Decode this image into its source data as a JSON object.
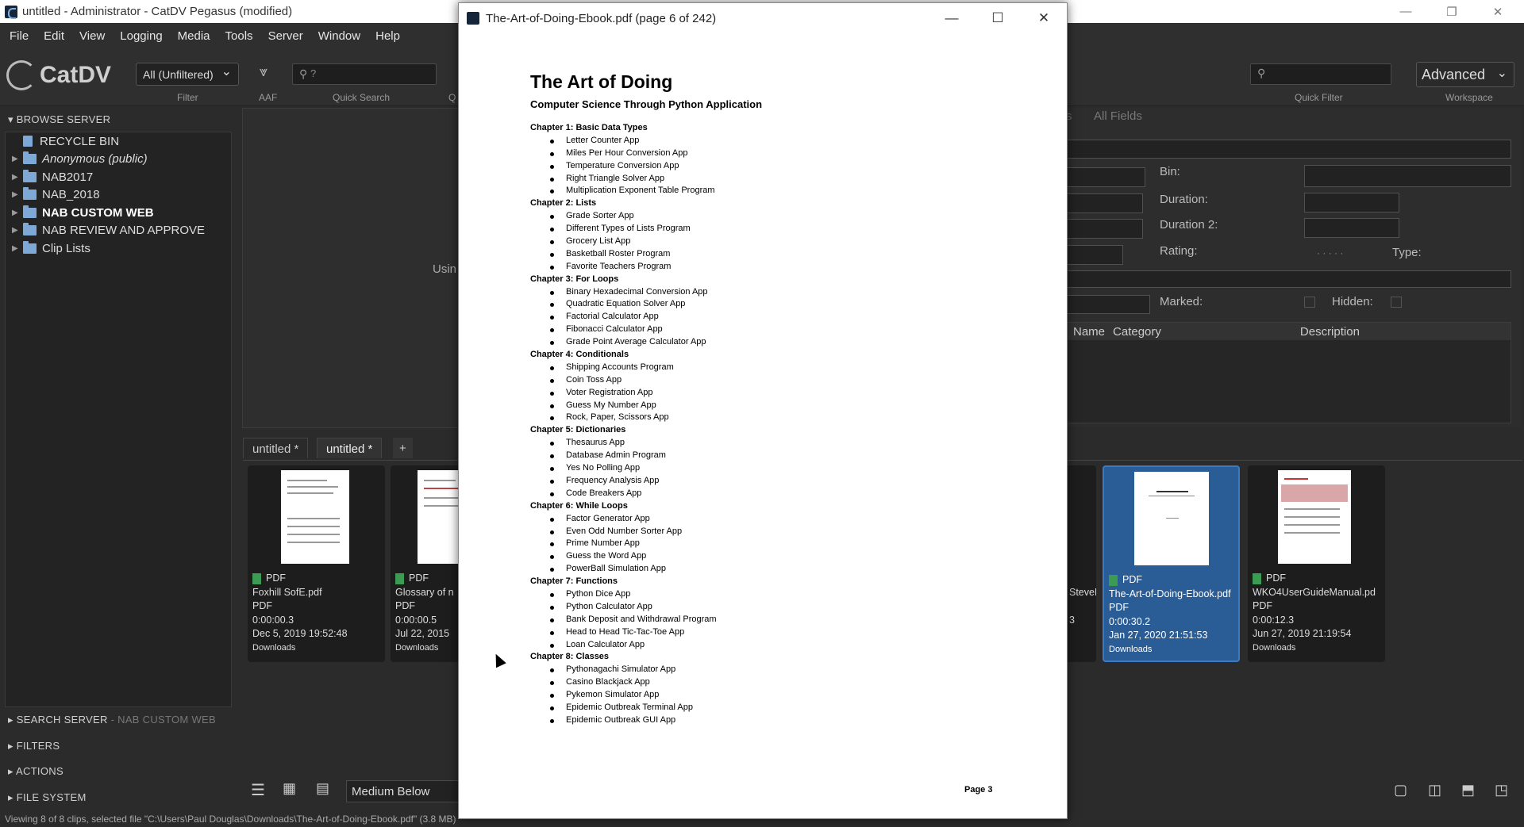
{
  "window": {
    "title": "untitled - Administrator - CatDV Pegasus (modified)"
  },
  "menu": [
    "File",
    "Edit",
    "View",
    "Logging",
    "Media",
    "Tools",
    "Server",
    "Window",
    "Help"
  ],
  "toolbar": {
    "logo": "CatDV",
    "filter_value": "All (Unfiltered)",
    "filter_label": "Filter",
    "aaf_label": "AAF",
    "quick_search_label": "Quick Search",
    "quick_search_placeholder": "?",
    "q_label": "Q",
    "quick_filter_label": "Quick Filter",
    "workspace_value": "Advanced",
    "workspace_label": "Workspace"
  },
  "sidebar": {
    "browse_header": "BROWSE SERVER",
    "tree": [
      {
        "label": "RECYCLE BIN",
        "type": "bin"
      },
      {
        "label": "Anonymous (public)",
        "type": "folder",
        "italic": true
      },
      {
        "label": "NAB2017",
        "type": "folder"
      },
      {
        "label": "NAB_2018",
        "type": "folder"
      },
      {
        "label": "NAB CUSTOM WEB",
        "type": "folder",
        "bold": true
      },
      {
        "label": "NAB REVIEW AND APPROVE",
        "type": "folder"
      },
      {
        "label": "Clip Lists",
        "type": "folder"
      }
    ],
    "search_header": "SEARCH SERVER",
    "search_sub": " - NAB CUSTOM WEB",
    "filters_header": "FILTERS",
    "actions_header": "ACTIONS",
    "filesystem_header": "FILE SYSTEM"
  },
  "center": {
    "partial_text": "Usin"
  },
  "details": {
    "tab_partial": "s",
    "tab_all_fields": "All Fields",
    "bin_label": "Bin:",
    "duration_label": "Duration:",
    "duration2_label": "Duration 2:",
    "rating_label": "Rating:",
    "rating_dots": "· · · · ·",
    "type_label": "Type:",
    "marked_label": "Marked:",
    "hidden_label": "Hidden:",
    "columns": [
      "Name",
      "Category",
      "Description"
    ]
  },
  "tabs": [
    "untitled *",
    "untitled *",
    "+"
  ],
  "clips": [
    {
      "name": "Foxhill SofE.pdf",
      "type": "PDF",
      "format": "PDF",
      "duration": "0:00:00.3",
      "date": "Dec 5, 2019 19:52:48",
      "folder": "Downloads"
    },
    {
      "name": "Glossary of n",
      "type": "PDF",
      "format": "PDF",
      "duration": "0:00:00.5",
      "date": "Jul 22, 2015",
      "folder": "Downloads"
    },
    {
      "name": "SteveF",
      "type": "",
      "format": "",
      "duration": "3",
      "date": "",
      "folder": ""
    },
    {
      "name": "The-Art-of-Doing-Ebook.pdf",
      "type": "PDF",
      "format": "PDF",
      "duration": "0:00:30.2",
      "date": "Jan 27, 2020 21:51:53",
      "folder": "Downloads"
    },
    {
      "name": "WKO4UserGuideManual.pd",
      "type": "PDF",
      "format": "PDF",
      "duration": "0:00:12.3",
      "date": "Jun 27, 2019 21:19:54",
      "folder": "Downloads"
    }
  ],
  "bottom": {
    "view_mode": "Medium Below"
  },
  "status": "Viewing 8 of 8 clips, selected file \"C:\\Users\\Paul Douglas\\Downloads\\The-Art-of-Doing-Ebook.pdf\" (3.8 MB)",
  "pdf": {
    "title": "The-Art-of-Doing-Ebook.pdf (page 6 of 242)",
    "heading": "The Art of Doing",
    "subheading": "Computer Science Through Python Application",
    "chapters": [
      {
        "title": "Chapter 1:  Basic Data Types",
        "items": [
          "Letter Counter App",
          "Miles Per Hour Conversion App",
          "Temperature Conversion App",
          "Right Triangle Solver App",
          "Multiplication Exponent Table Program"
        ]
      },
      {
        "title": "Chapter 2:  Lists",
        "items": [
          "Grade Sorter App",
          "Different Types of Lists Program",
          "Grocery List App",
          "Basketball Roster Program",
          "Favorite Teachers Program"
        ]
      },
      {
        "title": "Chapter 3:  For Loops",
        "items": [
          "Binary Hexadecimal Conversion App",
          "Quadratic Equation Solver App",
          "Factorial Calculator App",
          "Fibonacci Calculator App",
          "Grade Point Average Calculator App"
        ]
      },
      {
        "title": "Chapter 4:  Conditionals",
        "items": [
          "Shipping Accounts Program",
          "Coin Toss App",
          "Voter Registration App",
          "Guess My Number App",
          "Rock, Paper, Scissors App"
        ]
      },
      {
        "title": "Chapter 5:  Dictionaries",
        "items": [
          "Thesaurus App",
          "Database Admin Program",
          "Yes No Polling App",
          "Frequency Analysis App",
          "Code Breakers App"
        ]
      },
      {
        "title": "Chapter 6:  While Loops",
        "items": [
          "Factor Generator App",
          "Even Odd Number Sorter App",
          "Prime Number App",
          "Guess the Word App",
          "PowerBall Simulation App"
        ]
      },
      {
        "title": "Chapter 7:  Functions",
        "items": [
          "Python Dice App",
          "Python Calculator App",
          "Bank Deposit and Withdrawal Program",
          "Head to Head Tic-Tac-Toe App",
          "Loan Calculator App"
        ]
      },
      {
        "title": "Chapter 8:  Classes",
        "items": [
          "Pythonagachi Simulator App",
          "Casino Blackjack App",
          "Pykemon Simulator App",
          "Epidemic Outbreak Terminal App",
          "Epidemic Outbreak GUI App"
        ]
      }
    ],
    "page_number": "Page 3"
  }
}
